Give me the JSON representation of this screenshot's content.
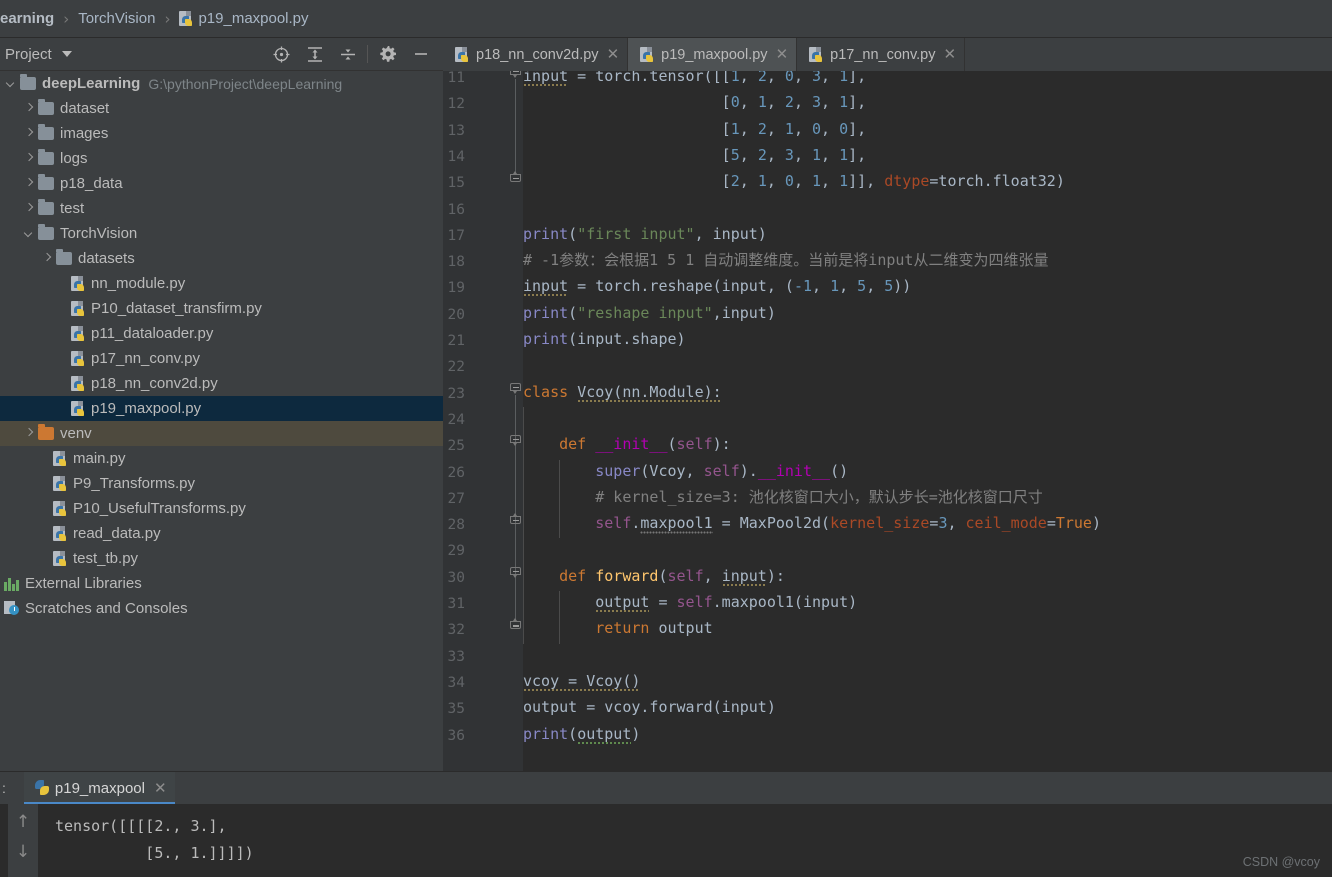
{
  "breadcrumb": {
    "items": [
      {
        "label": "earning",
        "bold": true,
        "icon": null
      },
      {
        "label": "TorchVision",
        "bold": false,
        "icon": null
      },
      {
        "label": "p19_maxpool.py",
        "bold": false,
        "icon": "python-file-icon"
      }
    ],
    "separator": "›"
  },
  "project_toolbar": {
    "title": "Project",
    "icons": [
      "select-opened-file-icon",
      "expand-all-icon",
      "collapse-all-icon",
      "settings-gear-icon",
      "hide-panel-icon"
    ]
  },
  "sidebar": {
    "items": [
      {
        "label": "deepLearning",
        "hint": "G:\\pythonProject\\deepLearning",
        "type": "folder",
        "indent": 0,
        "state": "open",
        "bold": true
      },
      {
        "label": "dataset",
        "type": "folder",
        "indent": 1,
        "state": "closed"
      },
      {
        "label": "images",
        "type": "folder",
        "indent": 1,
        "state": "closed"
      },
      {
        "label": "logs",
        "type": "folder",
        "indent": 1,
        "state": "closed"
      },
      {
        "label": "p18_data",
        "type": "folder",
        "indent": 1,
        "state": "closed"
      },
      {
        "label": "test",
        "type": "folder",
        "indent": 1,
        "state": "closed"
      },
      {
        "label": "TorchVision",
        "type": "folder",
        "indent": 1,
        "state": "open"
      },
      {
        "label": "datasets",
        "type": "folder",
        "indent": 2,
        "state": "closed"
      },
      {
        "label": "nn_module.py",
        "type": "python",
        "indent": 3
      },
      {
        "label": "P10_dataset_transfirm.py",
        "type": "python",
        "indent": 3
      },
      {
        "label": "p11_dataloader.py",
        "type": "python",
        "indent": 3
      },
      {
        "label": "p17_nn_conv.py",
        "type": "python",
        "indent": 3
      },
      {
        "label": "p18_nn_conv2d.py",
        "type": "python",
        "indent": 3
      },
      {
        "label": "p19_maxpool.py",
        "type": "python",
        "indent": 3,
        "selected": true
      },
      {
        "label": "venv",
        "type": "folder-orange",
        "indent": 1,
        "state": "closed",
        "highlight": true
      },
      {
        "label": "main.py",
        "type": "python",
        "indent": 2
      },
      {
        "label": "P9_Transforms.py",
        "type": "python",
        "indent": 2
      },
      {
        "label": "P10_UsefulTransforms.py",
        "type": "python",
        "indent": 2
      },
      {
        "label": "read_data.py",
        "type": "python",
        "indent": 2
      },
      {
        "label": "test_tb.py",
        "type": "python",
        "indent": 2
      },
      {
        "label": "External Libraries",
        "type": "libraries",
        "indent": 0
      },
      {
        "label": "Scratches and Consoles",
        "type": "scratches",
        "indent": 0
      }
    ]
  },
  "editor_tabs": [
    {
      "label": "p18_nn_conv2d.py",
      "active": false,
      "close": "✕"
    },
    {
      "label": "p19_maxpool.py",
      "active": true,
      "close": "✕"
    },
    {
      "label": "p17_nn_conv.py",
      "active": false,
      "close": "✕"
    }
  ],
  "editor": {
    "first_line_number": 11,
    "line_numbers": [
      11,
      12,
      13,
      14,
      15,
      16,
      17,
      18,
      19,
      20,
      21,
      22,
      23,
      24,
      25,
      26,
      27,
      28,
      29,
      30,
      31,
      32,
      33,
      34,
      35,
      36
    ],
    "lines": [
      "input = torch.tensor([[1, 2, 0, 3, 1],",
      "                      [0, 1, 2, 3, 1],",
      "                      [1, 2, 1, 0, 0],",
      "                      [5, 2, 3, 1, 1],",
      "                      [2, 1, 0, 1, 1]], dtype=torch.float32)",
      "",
      "print(\"first input\", input)",
      "# -1参数：会根据1 5 1 自动调整维度。当前是将input从二维变为四维张量",
      "input = torch.reshape(input, (-1, 1, 5, 5))",
      "print(\"reshape input\",input)",
      "print(input.shape)",
      "",
      "class Vcoy(nn.Module):",
      "",
      "    def __init__(self):",
      "        super(Vcoy, self).__init__()",
      "        # kernel_size=3: 池化核窗口大小，默认步长=池化核窗口尺寸",
      "        self.maxpool1 = MaxPool2d(kernel_size=3, ceil_mode=True)",
      "",
      "    def forward(self, input):",
      "        output = self.maxpool1(input)",
      "        return output",
      "",
      "vcoy = Vcoy()",
      "output = vcoy.forward(input)",
      "print(output)"
    ]
  },
  "console": {
    "prefix": ":",
    "tab_label": "p19_maxpool",
    "tab_close": "✕",
    "nav_up": "↑",
    "nav_down": "↓",
    "output_lines": [
      "tensor([[[[2., 3.],",
      "          [5., 1.]]]])"
    ]
  },
  "watermark": "CSDN @vcoy",
  "colors": {
    "chrome": "#3c3f41",
    "editor_bg": "#2b2b2b",
    "gutter_bg": "#313335",
    "selection": "#0d293e",
    "venv_highlight": "#4e4a3e",
    "accent": "#4a88c7",
    "keyword": "#cc7832",
    "string": "#6a8759",
    "number": "#6897bb",
    "comment": "#808080",
    "function": "#ffc66d",
    "text": "#a9b7c6"
  }
}
